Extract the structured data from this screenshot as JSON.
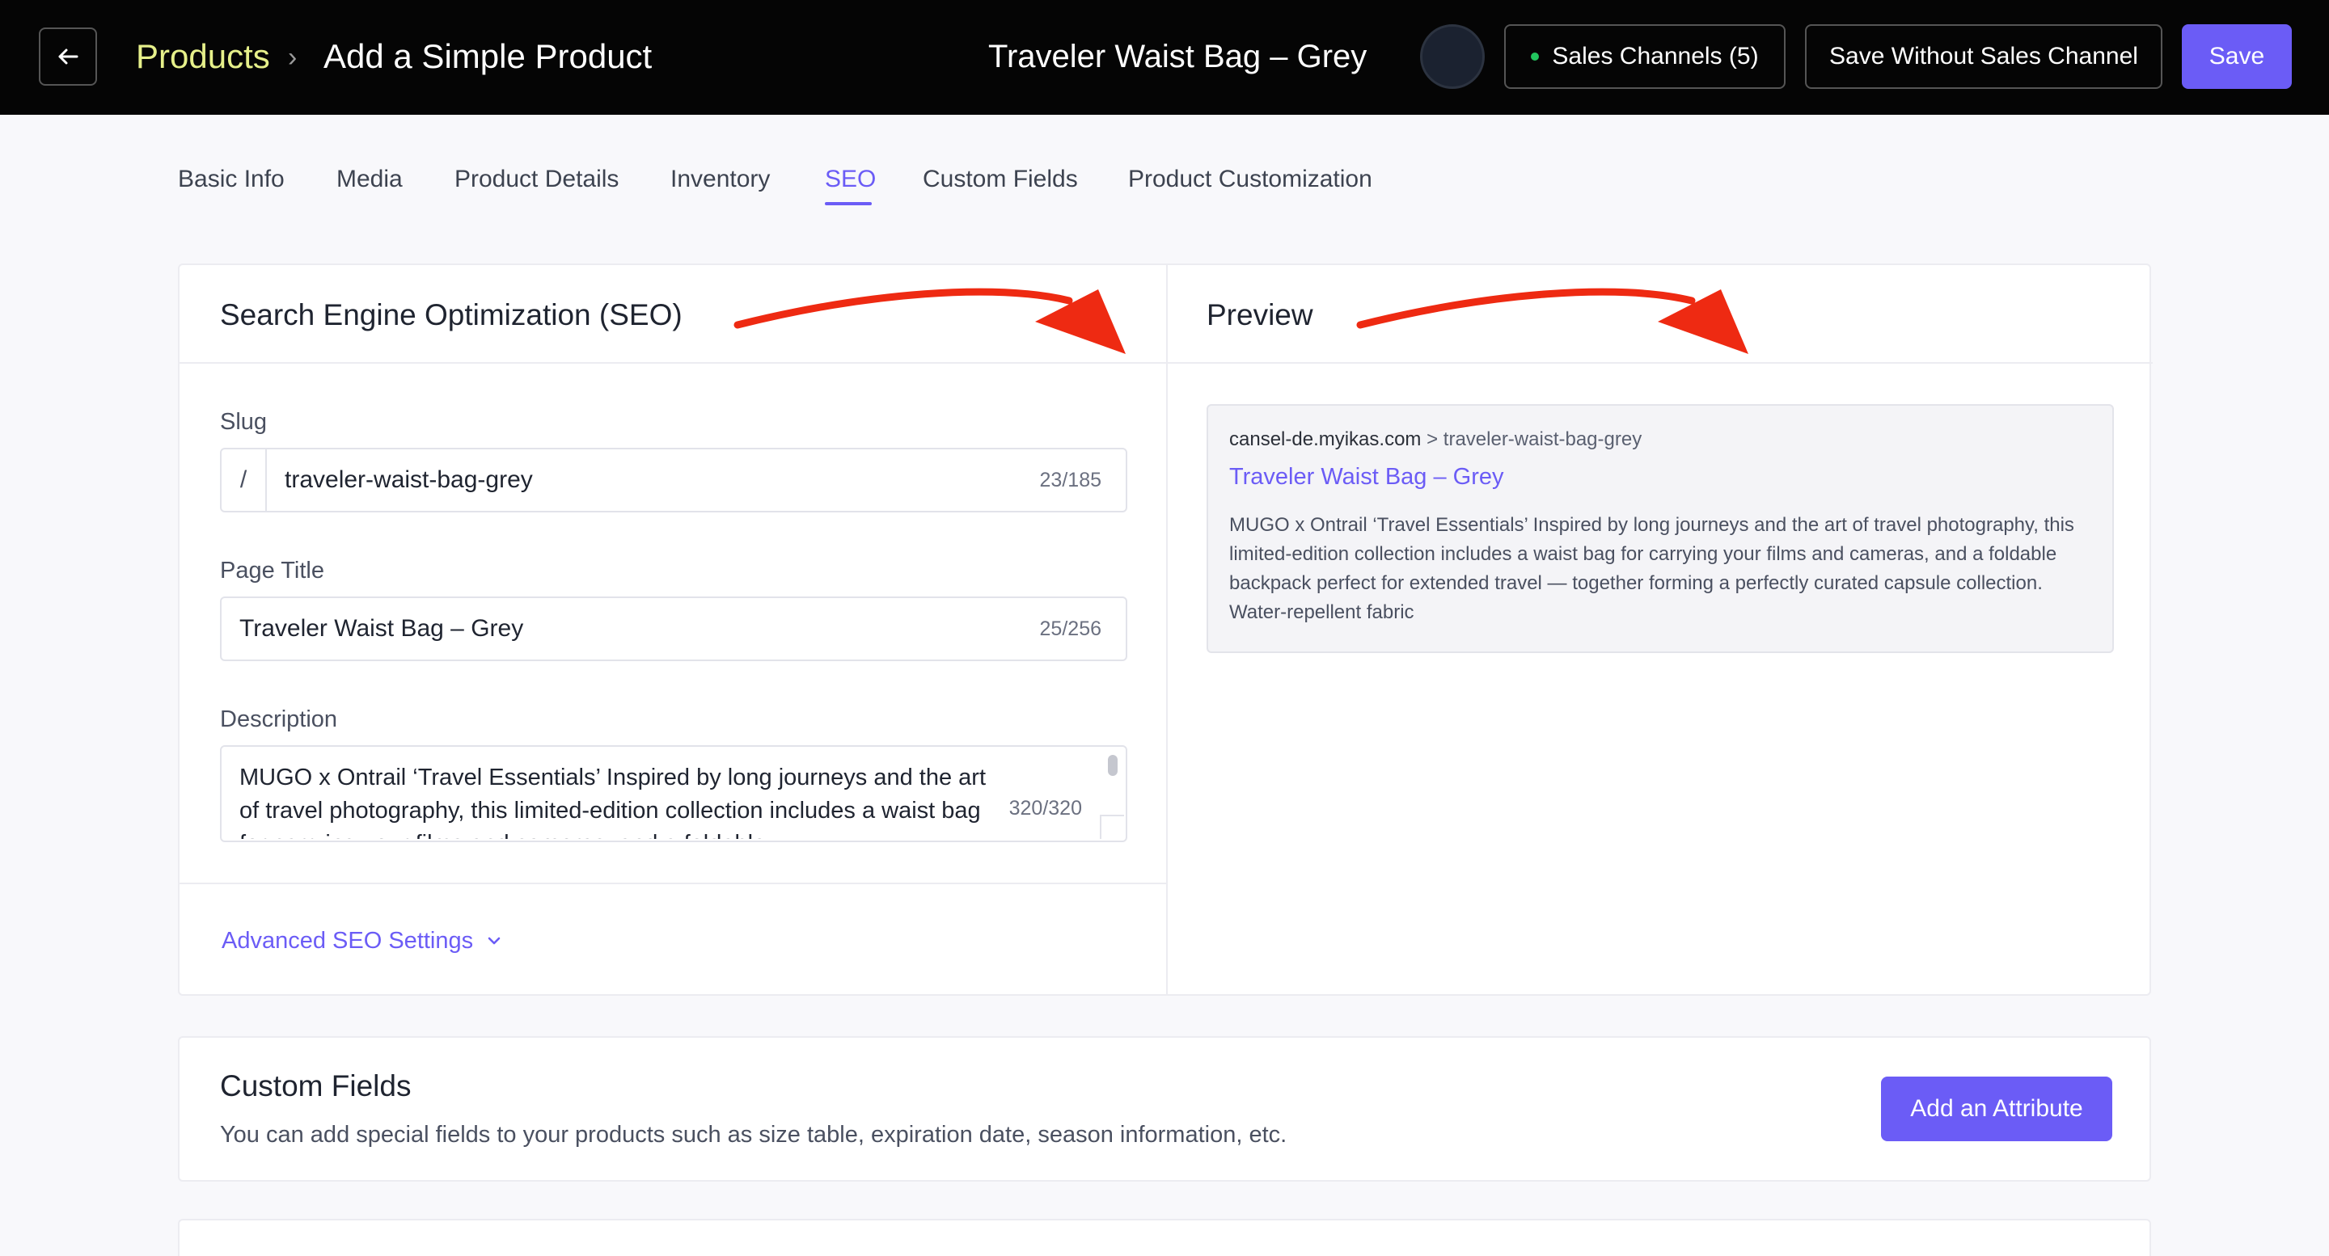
{
  "header": {
    "breadcrumb_root": "Products",
    "breadcrumb_separator": "›",
    "breadcrumb_current": "Add a Simple Product",
    "product_name": "Traveler Waist Bag – Grey",
    "sales_channels_label": "Sales Channels (5)",
    "save_without_channel_label": "Save Without Sales Channel",
    "save_label": "Save"
  },
  "tabs": [
    {
      "label": "Basic Info"
    },
    {
      "label": "Media"
    },
    {
      "label": "Product Details"
    },
    {
      "label": "Inventory"
    },
    {
      "label": "SEO",
      "active": true
    },
    {
      "label": "Custom Fields"
    },
    {
      "label": "Product Customization"
    }
  ],
  "seo": {
    "title": "Search Engine Optimization (SEO)",
    "slug_label": "Slug",
    "slug_prefix": "/",
    "slug_value": "traveler-waist-bag-grey",
    "slug_counter": "23/185",
    "page_title_label": "Page Title",
    "page_title_value": "Traveler Waist Bag – Grey",
    "page_title_counter": "25/256",
    "description_label": "Description",
    "description_value": "MUGO x Ontrail ‘Travel Essentials’ Inspired by long journeys and the art of travel photography, this limited-edition collection includes a waist bag for carrying your films and cameras, and a foldable",
    "description_counter": "320/320",
    "advanced_label": "Advanced SEO Settings"
  },
  "preview": {
    "title": "Preview",
    "domain": "cansel-de.myikas.com",
    "separator": ">",
    "path": "traveler-waist-bag-grey",
    "page_title": "Traveler Waist Bag – Grey",
    "description": "MUGO x Ontrail ‘Travel Essentials’ Inspired by long journeys and the art of travel photography, this limited-edition collection includes a waist bag for carrying your films and cameras, and a foldable backpack perfect for extended travel — together forming a perfectly curated capsule collection. Water-repellent fabric"
  },
  "custom_fields": {
    "title": "Custom Fields",
    "description": "You can add special fields to your products such as size table, expiration date, season information, etc.",
    "add_button_label": "Add an Attribute"
  },
  "colors": {
    "accent": "#6b5cf6",
    "breadcrumb_root": "#e6f08a",
    "annotation_arrow": "#ee2a12",
    "status_dot": "#22c55e"
  },
  "icons": [
    "arrow-left-icon",
    "chevron-right-icon",
    "chevron-down-icon",
    "annotation-arrow-icon"
  ]
}
